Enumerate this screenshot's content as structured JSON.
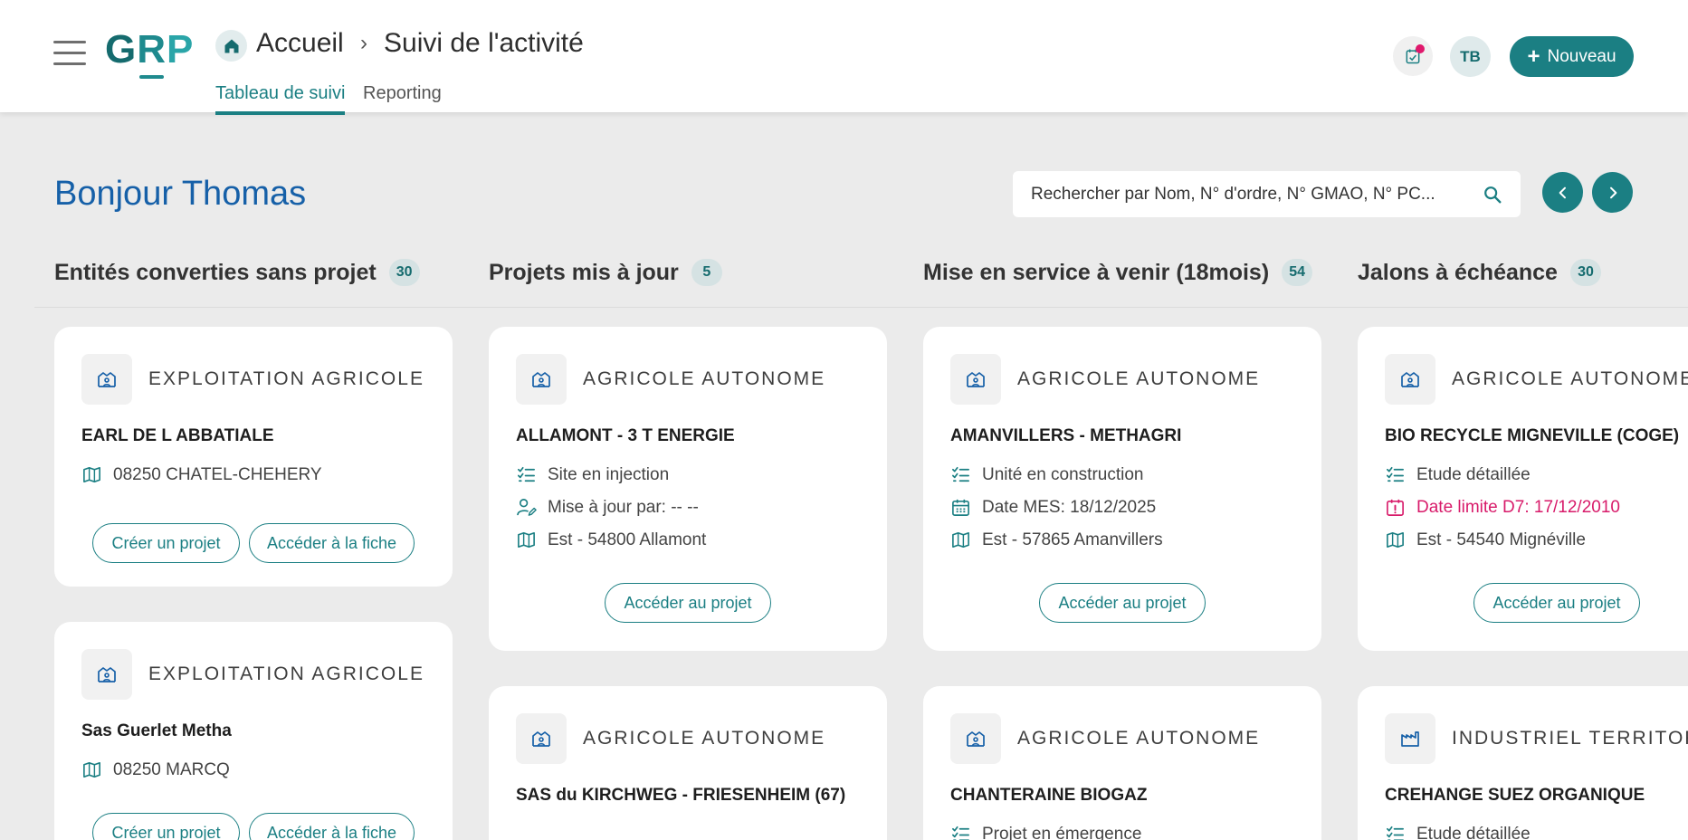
{
  "header": {
    "logo": {
      "g": "G",
      "r": "R",
      "p": "P"
    },
    "breadcrumb": {
      "root": "Accueil",
      "separator": "›",
      "current": "Suivi de l'activité"
    },
    "tabs": [
      {
        "label": "Tableau de suivi",
        "active": true
      },
      {
        "label": "Reporting",
        "active": false
      }
    ],
    "avatar_initials": "TB",
    "new_button": {
      "icon": "+",
      "label": "Nouveau"
    },
    "accent_color": "#1b7f83",
    "notification_color": "#e0186c"
  },
  "main": {
    "greeting": "Bonjour Thomas",
    "search": {
      "text": "Rechercher par Nom, N° d'ordre, N° GMAO, N° PC..."
    },
    "columns": [
      {
        "title": "Entités converties sans projet",
        "count": "30",
        "cards": [
          {
            "type": "EXPLOITATION AGRICOLE",
            "name": "EARL DE L ABBATIALE",
            "location": "08250 CHATEL-CHEHERY",
            "btn_create": "Créer un projet",
            "btn_sheet": "Accéder à la fiche"
          },
          {
            "type": "EXPLOITATION AGRICOLE",
            "name": "Sas Guerlet Metha",
            "location": "08250 MARCQ",
            "btn_create": "Créer un projet",
            "btn_sheet": "Accéder à la fiche"
          }
        ]
      },
      {
        "title": "Projets mis à jour",
        "count": "5",
        "cards": [
          {
            "type": "AGRICOLE AUTONOME",
            "name": "ALLAMONT - 3 T ENERGIE",
            "status": "Site en injection",
            "updated_by": "Mise à jour par: -- --",
            "location": "Est - 54800 Allamont",
            "button": "Accéder au projet"
          },
          {
            "type": "AGRICOLE AUTONOME",
            "name": "SAS du KIRCHWEG - FRIESENHEIM (67)"
          }
        ]
      },
      {
        "title": "Mise en service à venir (18mois)",
        "count": "54",
        "cards": [
          {
            "type": "AGRICOLE AUTONOME",
            "name": "AMANVILLERS - METHAGRI",
            "status": "Unité en construction",
            "date": "Date MES: 18/12/2025",
            "location": "Est - 57865 Amanvillers",
            "button": "Accéder au projet"
          },
          {
            "type": "AGRICOLE AUTONOME",
            "name": "CHANTERAINE BIOGAZ",
            "status": "Projet en émergence"
          }
        ]
      },
      {
        "title": "Jalons à échéance",
        "count": "30",
        "cards": [
          {
            "type": "AGRICOLE AUTONOME",
            "name": "BIO RECYCLE MIGNEVILLE (COGE)",
            "status": "Etude détaillée",
            "deadline": "Date limite D7: 17/12/2010",
            "location": "Est - 54540 Mignéville",
            "button": "Accéder au projet"
          },
          {
            "type": "INDUSTRIEL TERRITORIAL",
            "name": "CREHANGE SUEZ ORGANIQUE",
            "status": "Etude détaillée"
          }
        ]
      }
    ],
    "icons": {
      "farm": "building-people-icon",
      "industry": "factory-icon",
      "map": "map-icon",
      "status": "checklist-icon",
      "user": "user-edit-icon",
      "calendar": "calendar-icon",
      "deadline": "calendar-alert-icon"
    },
    "deadline_color": "#d81b6a",
    "title_color": "#1660a8"
  }
}
